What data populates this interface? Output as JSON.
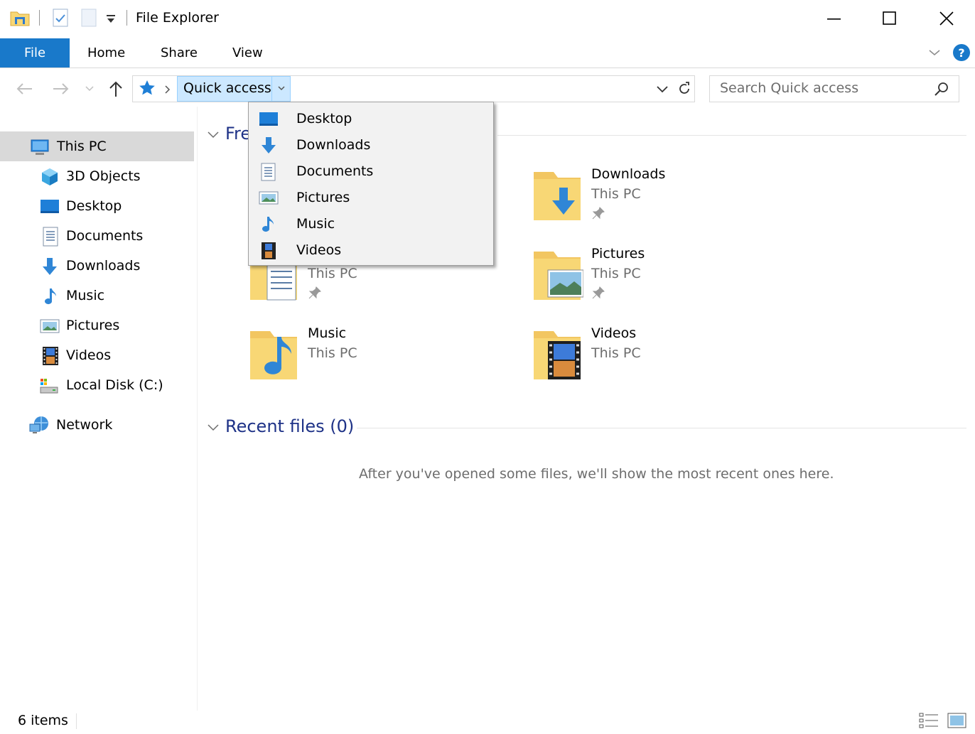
{
  "window": {
    "title": "File Explorer"
  },
  "ribbon": {
    "tabs": [
      "File",
      "Home",
      "Share",
      "View"
    ]
  },
  "address": {
    "location": "Quick access",
    "search_placeholder": "Search Quick access"
  },
  "nav": {
    "this_pc": "This PC",
    "items": [
      "3D Objects",
      "Desktop",
      "Documents",
      "Downloads",
      "Music",
      "Pictures",
      "Videos",
      "Local Disk (C:)"
    ],
    "network": "Network"
  },
  "content": {
    "frequent_header_visible": "Fre",
    "tiles": [
      {
        "name": "Downloads",
        "location": "This PC"
      },
      {
        "name": "Pictures",
        "location": "This PC"
      },
      {
        "name": "",
        "location": "This PC"
      },
      {
        "name": "Music",
        "location": "This PC"
      },
      {
        "name": "Videos",
        "location": "This PC"
      }
    ],
    "recent_header": "Recent files (0)",
    "recent_empty_message": "After you've opened some files, we'll show the most recent ones here."
  },
  "dropdown": {
    "items": [
      "Desktop",
      "Downloads",
      "Documents",
      "Pictures",
      "Music",
      "Videos"
    ]
  },
  "status": {
    "item_count": "6 items"
  },
  "colors": {
    "accent": "#1979ca",
    "link_header": "#1e3287",
    "selection": "#cce8ff",
    "folder": "#f8d775"
  }
}
